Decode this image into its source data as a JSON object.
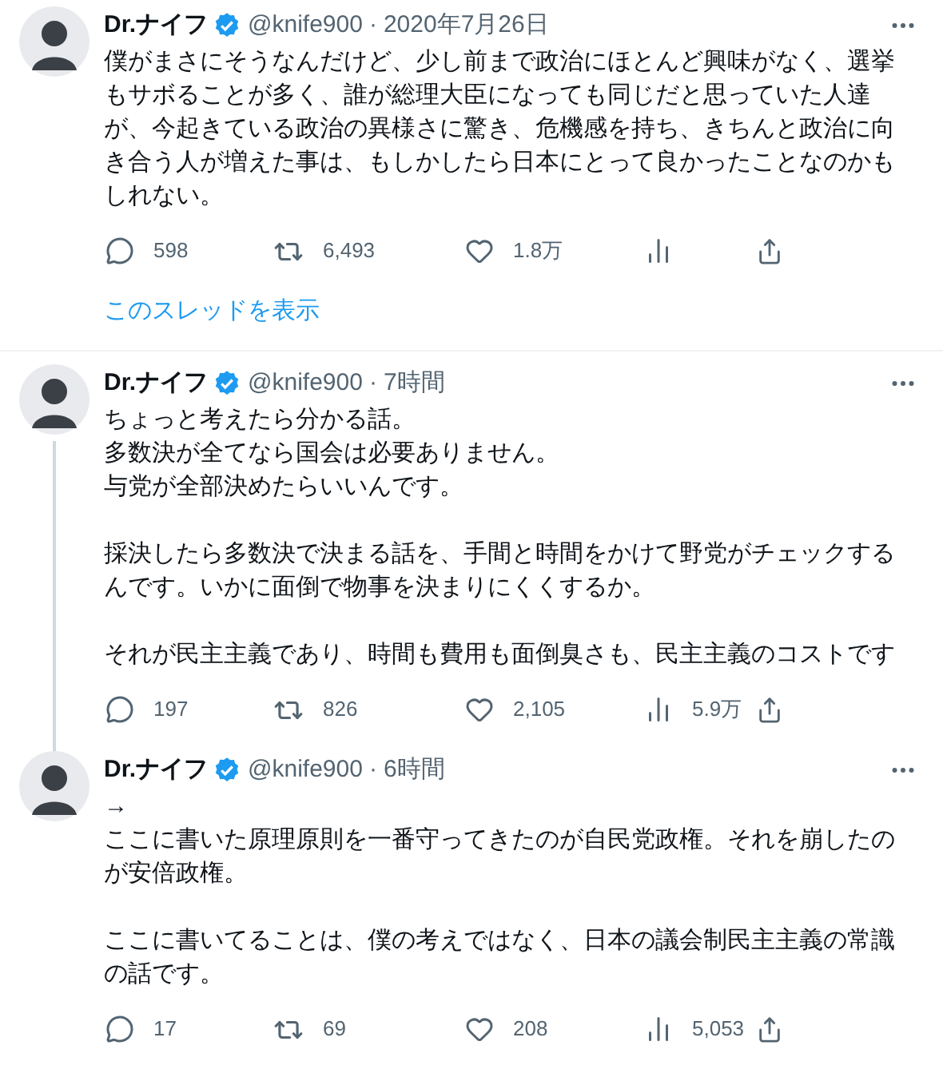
{
  "tweets": [
    {
      "name": "Dr.ナイフ",
      "verified": true,
      "handle": "@knife900",
      "separator": "·",
      "time": "2020年7月26日",
      "thread_line": false,
      "body": [
        [
          "僕がまさにそうなんだけど、少し前まで政治にほとんど興味がなく、選挙もサボることが多く、誰が総理大臣になっても同じだと思っていた人達が、今起きている政治の異様さに驚き、危機感を持ち、きちんと政治に向き合う人が増えた事は、もしかしたら日本にとって良かったことなのかもしれない。"
        ]
      ],
      "replies": "598",
      "retweets": "6,493",
      "likes": "1.8万",
      "show_thread": "このスレッドを表示"
    },
    {
      "name": "Dr.ナイフ",
      "verified": true,
      "handle": "@knife900",
      "separator": "·",
      "time": "7時間",
      "thread_line": true,
      "body": [
        [
          "ちょっと考えたら分かる話。",
          "多数決が全てなら国会は必要ありません。",
          "与党が全部決めたらいいんです。"
        ],
        [
          "採決したら多数決で決まる話を、手間と時間をかけて野党がチェックするんです。いかに面倒で物事を決まりにくくするか。"
        ],
        [
          "それが民主主義であり、時間も費用も面倒臭さも、民主主義のコストです"
        ]
      ],
      "replies": "197",
      "retweets": "826",
      "likes": "2,105",
      "views": "5.9万"
    },
    {
      "name": "Dr.ナイフ",
      "verified": true,
      "handle": "@knife900",
      "separator": "·",
      "time": "6時間",
      "thread_line": false,
      "body": [
        [
          "→",
          "ここに書いた原理原則を一番守ってきたのが自民党政権。それを崩したのが安倍政権。"
        ],
        [
          "ここに書いてることは、僕の考えではなく、日本の議会制民主主義の常識の話です。"
        ]
      ],
      "replies": "17",
      "retweets": "69",
      "likes": "208",
      "views": "5,053"
    }
  ]
}
